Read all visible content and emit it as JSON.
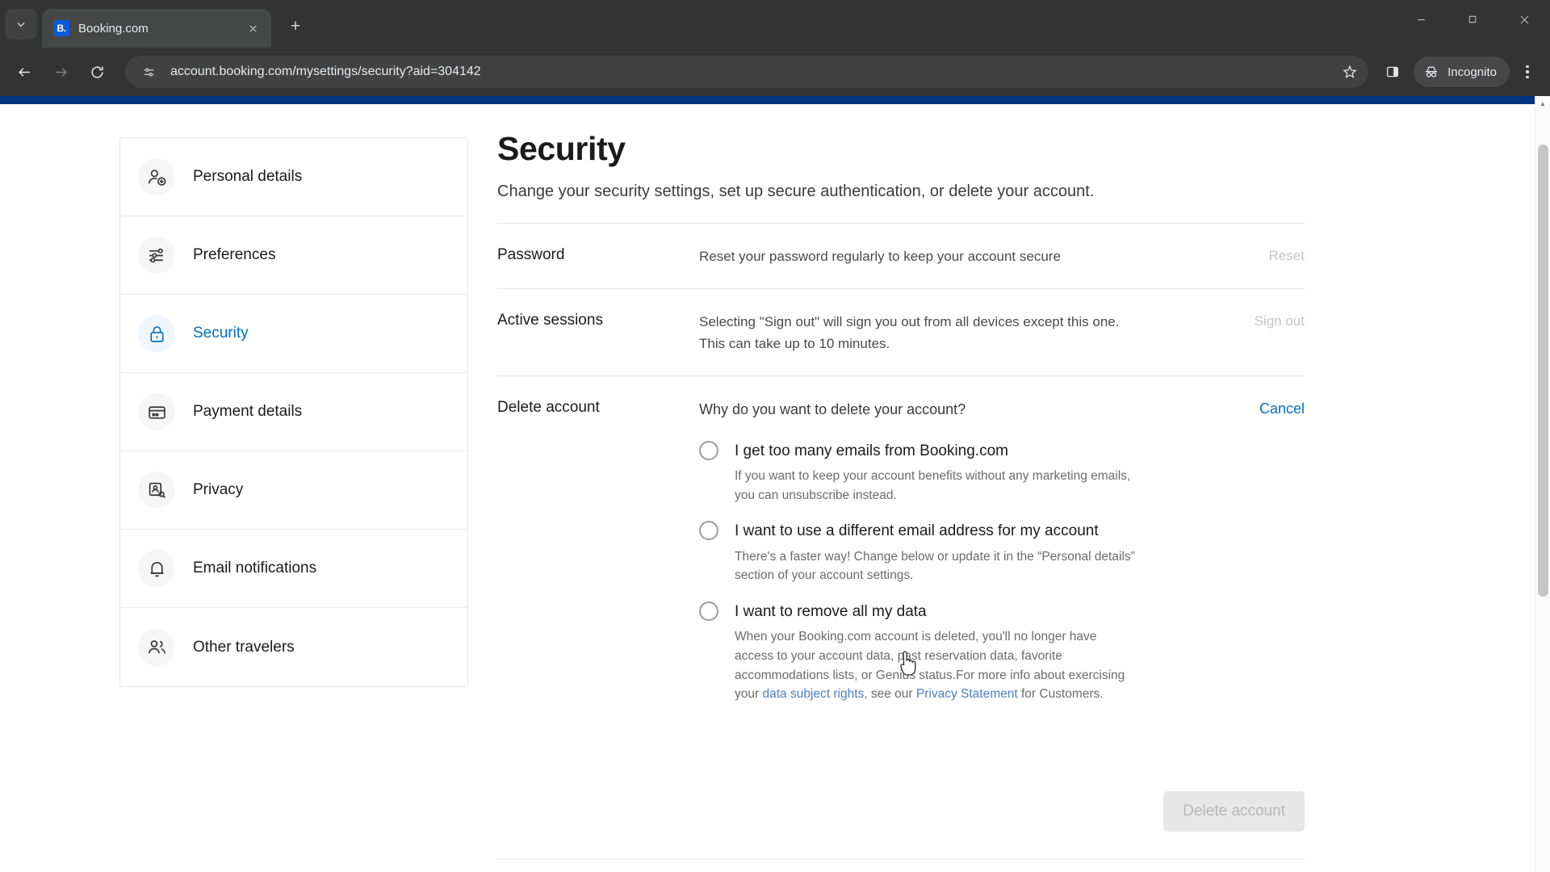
{
  "browser": {
    "tab": {
      "title": "Booking.com",
      "favicon_label": "B.",
      "favicon_color": "#0a5ad6"
    },
    "new_tab_label": "+",
    "window": {
      "minimize": "—",
      "maximize": "❐",
      "close": "✕"
    },
    "url": "account.booking.com/mysettings/security?aid=304142",
    "profile_label": "Incognito"
  },
  "sidebar": {
    "items": [
      {
        "label": "Personal details",
        "icon": "person-add-icon",
        "active": false
      },
      {
        "label": "Preferences",
        "icon": "sliders-icon",
        "active": false
      },
      {
        "label": "Security",
        "icon": "lock-icon",
        "active": true
      },
      {
        "label": "Payment details",
        "icon": "credit-card-icon",
        "active": false
      },
      {
        "label": "Privacy",
        "icon": "privacy-id-icon",
        "active": false
      },
      {
        "label": "Email notifications",
        "icon": "bell-icon",
        "active": false
      },
      {
        "label": "Other travelers",
        "icon": "people-icon",
        "active": false
      }
    ]
  },
  "main": {
    "title": "Security",
    "subtitle": "Change your security settings, set up secure authentication, or delete your account.",
    "rows": {
      "password": {
        "label": "Password",
        "description": "Reset your password regularly to keep your account secure",
        "action": "Reset"
      },
      "active_sessions": {
        "label": "Active sessions",
        "description": "Selecting \"Sign out\" will sign you out from all devices except this one. This can take up to 10 minutes.",
        "action": "Sign out"
      },
      "delete_account": {
        "label": "Delete account",
        "question": "Why do you want to delete your account?",
        "action": "Cancel"
      }
    },
    "options": [
      {
        "title": "I get too many emails from Booking.com",
        "description": "If you want to keep your account benefits without any marketing emails, you can unsubscribe instead.",
        "selected": false
      },
      {
        "title": "I want to use a different email address for my account",
        "description": "There's a faster way! Change below or update it in the “Personal details” section of your account settings.",
        "selected": false
      },
      {
        "title": "I want to remove all my data",
        "description_part1": "When your Booking.com account is deleted, you'll no longer have access to your account data, past reservation data, favorite accommodations lists, or Genius status.For more info about exercising your ",
        "link1": "data subject rights",
        "description_part2": ", see our ",
        "link2": "Privacy Statement",
        "description_part3": " for Customers.",
        "selected": false
      }
    ],
    "delete_button": "Delete account"
  },
  "colors": {
    "brand_blue": "#003580",
    "link_blue": "#0071c2",
    "disabled_grey": "#c4c4c4"
  }
}
